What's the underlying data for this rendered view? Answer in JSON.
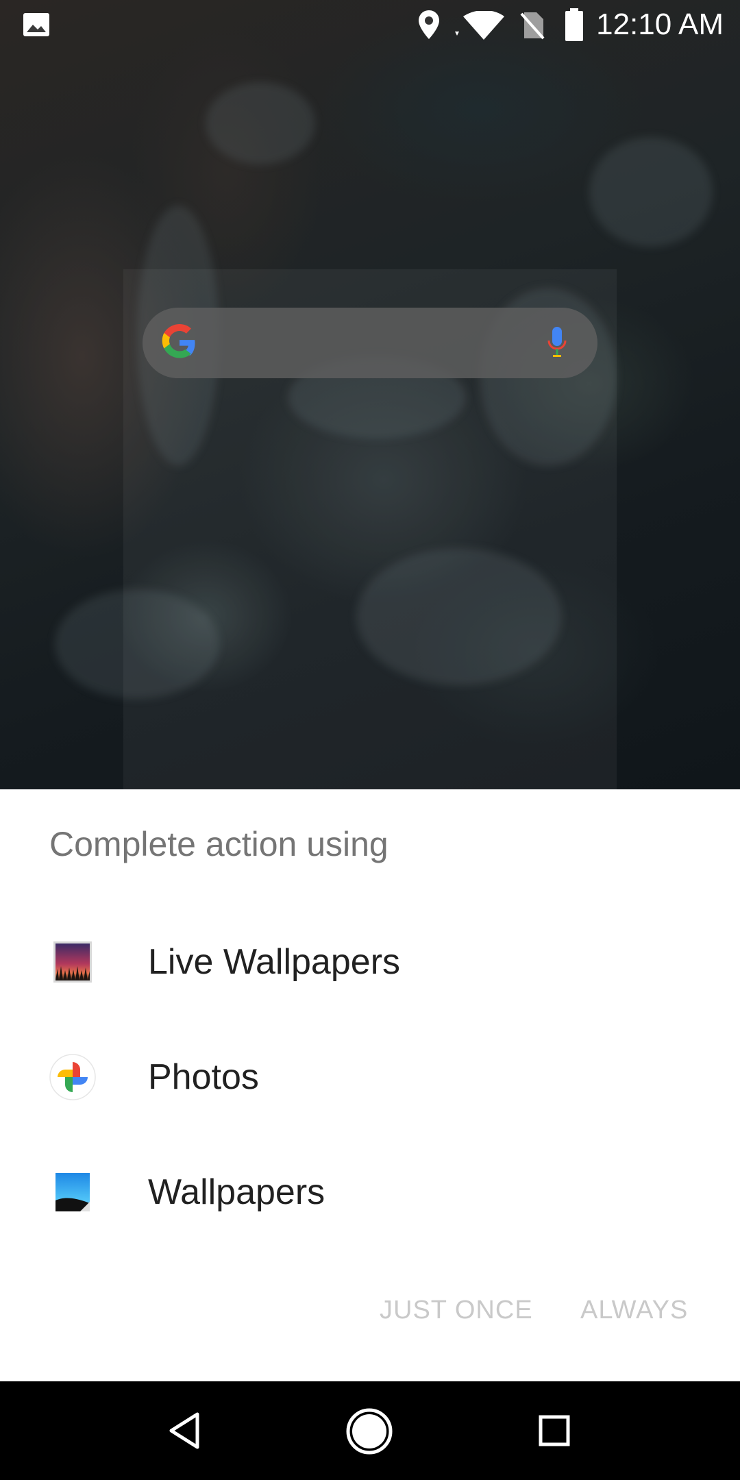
{
  "status_bar": {
    "time": "12:10 AM",
    "icons": [
      "image-notification-icon",
      "location-icon",
      "wifi-icon",
      "no-sim-icon",
      "battery-icon"
    ]
  },
  "home": {
    "search_widget": {
      "logo": "google-g-icon",
      "mic": "mic-icon"
    }
  },
  "dialog": {
    "title": "Complete action using",
    "apps": [
      {
        "label": "Live Wallpapers",
        "icon": "live-wallpapers-icon"
      },
      {
        "label": "Photos",
        "icon": "photos-pinwheel-icon"
      },
      {
        "label": "Wallpapers",
        "icon": "wallpapers-icon"
      }
    ],
    "buttons": {
      "just_once": "JUST ONCE",
      "always": "ALWAYS"
    },
    "button_color_disabled": "#c9c9c9"
  },
  "nav_bar": {
    "buttons": [
      "back-icon",
      "home-icon",
      "recents-icon"
    ]
  }
}
